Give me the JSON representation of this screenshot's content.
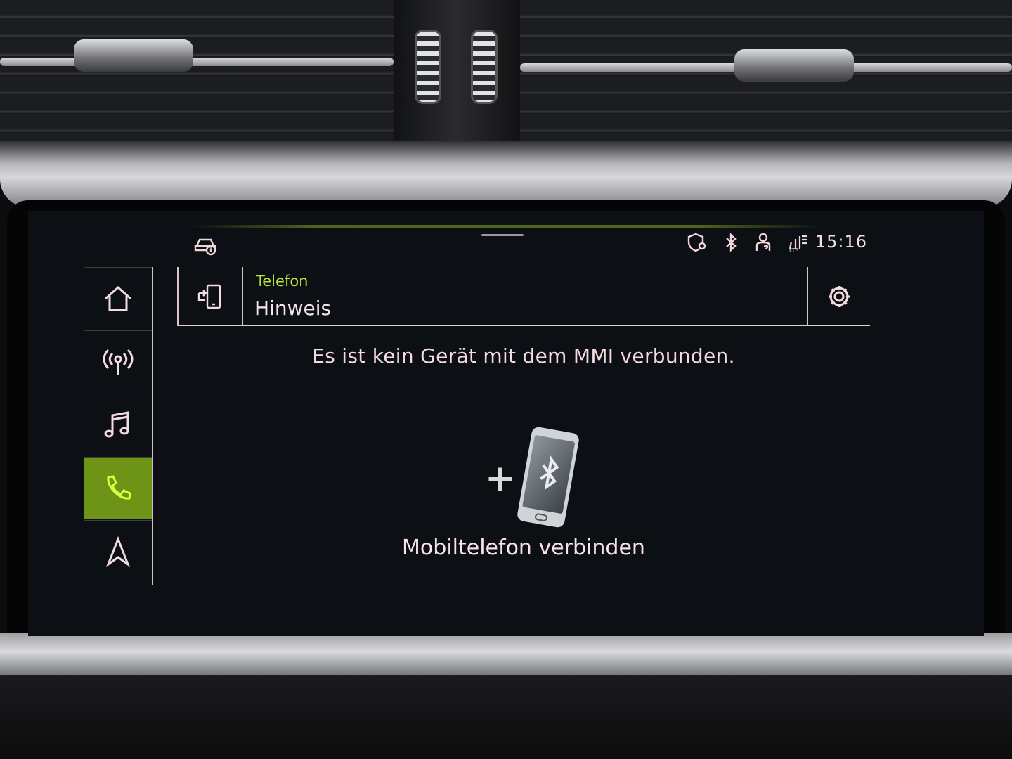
{
  "status_bar": {
    "time": "15:16",
    "icons": [
      "car-info-icon",
      "shield-location-icon",
      "bluetooth-icon",
      "user-help-icon",
      "lte-icon"
    ]
  },
  "sidenav": {
    "items": [
      {
        "icon": "home-icon",
        "active": false
      },
      {
        "icon": "radio-icon",
        "active": false
      },
      {
        "icon": "music-icon",
        "active": false
      },
      {
        "icon": "phone-icon",
        "active": true
      },
      {
        "icon": "navigation-icon",
        "active": false
      }
    ]
  },
  "header": {
    "breadcrumb": "Telefon",
    "title": "Hinweis",
    "left_icon": "phone-transfer-icon",
    "right_icon": "gear-icon"
  },
  "content": {
    "message": "Es ist kein Gerät mit dem MMI verbunden.",
    "action_label": "Mobiltelefon verbinden",
    "action_icon": "bluetooth-phone-add-icon"
  },
  "colors": {
    "accent": "#6d9416",
    "accent_text": "#b6e335",
    "text": "#f6e6e8"
  }
}
